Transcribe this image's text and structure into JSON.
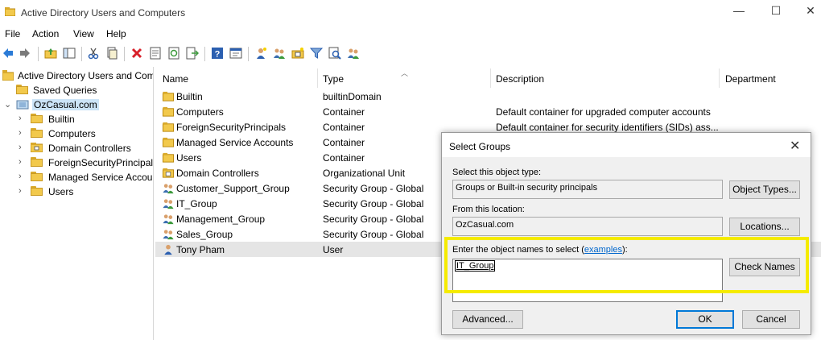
{
  "window": {
    "title": "Active Directory Users and Computers",
    "minimize": "—",
    "maximize": "☐",
    "close": "✕"
  },
  "menu": [
    "File",
    "Action",
    "View",
    "Help"
  ],
  "toolbar": {
    "icons": [
      "back-arrow-icon",
      "forward-arrow-icon",
      "up-folder-icon",
      "show-tree-icon",
      "cut-icon",
      "copy-icon",
      "delete-icon",
      "properties-icon",
      "refresh-icon",
      "export-icon",
      "help-icon",
      "console-icon",
      "new-user-icon",
      "new-group-icon",
      "new-ou-icon",
      "filter-icon",
      "find-icon",
      "add-to-group-icon"
    ]
  },
  "tree": {
    "root": "Active Directory Users and Com",
    "saved_queries": "Saved Queries",
    "domain": "OzCasual.com",
    "children": [
      "Builtin",
      "Computers",
      "Domain Controllers",
      "ForeignSecurityPrincipals",
      "Managed Service Accour",
      "Users"
    ]
  },
  "list": {
    "columns": [
      "Name",
      "Type",
      "Description",
      "Department"
    ],
    "rows": [
      {
        "name": "Builtin",
        "type": "builtinDomain",
        "description": "",
        "icon": "builtin-folder-icon"
      },
      {
        "name": "Computers",
        "type": "Container",
        "description": "Default container for upgraded computer accounts",
        "icon": "folder-icon"
      },
      {
        "name": "ForeignSecurityPrincipals",
        "type": "Container",
        "description": "Default container for security identifiers (SIDs) ass...",
        "icon": "folder-icon"
      },
      {
        "name": "Managed Service Accounts",
        "type": "Container",
        "description": "",
        "icon": "folder-icon"
      },
      {
        "name": "Users",
        "type": "Container",
        "description": "",
        "icon": "folder-icon"
      },
      {
        "name": "Domain Controllers",
        "type": "Organizational Unit",
        "description": "",
        "icon": "ou-icon"
      },
      {
        "name": "Customer_Support_Group",
        "type": "Security Group - Global",
        "description": "",
        "icon": "group-icon"
      },
      {
        "name": "IT_Group",
        "type": "Security Group - Global",
        "description": "",
        "icon": "group-icon"
      },
      {
        "name": "Management_Group",
        "type": "Security Group - Global",
        "description": "",
        "icon": "group-icon"
      },
      {
        "name": "Sales_Group",
        "type": "Security Group - Global",
        "description": "",
        "icon": "group-icon"
      },
      {
        "name": "Tony Pham",
        "type": "User",
        "description": "",
        "icon": "user-icon"
      }
    ]
  },
  "dialog": {
    "title": "Select Groups",
    "object_type_label": "Select this object type:",
    "object_type_value": "Groups or Built-in security principals",
    "object_types_button": "Object Types...",
    "location_label": "From this location:",
    "location_value": "OzCasual.com",
    "locations_button": "Locations...",
    "names_label_prefix": "Enter the object names to select (",
    "names_label_link": "examples",
    "names_label_suffix": "):",
    "names_value": "IT_Group",
    "check_names_button": "Check Names",
    "advanced_button": "Advanced...",
    "ok_button": "OK",
    "cancel_button": "Cancel",
    "highlight_color": "#f5eb00"
  }
}
